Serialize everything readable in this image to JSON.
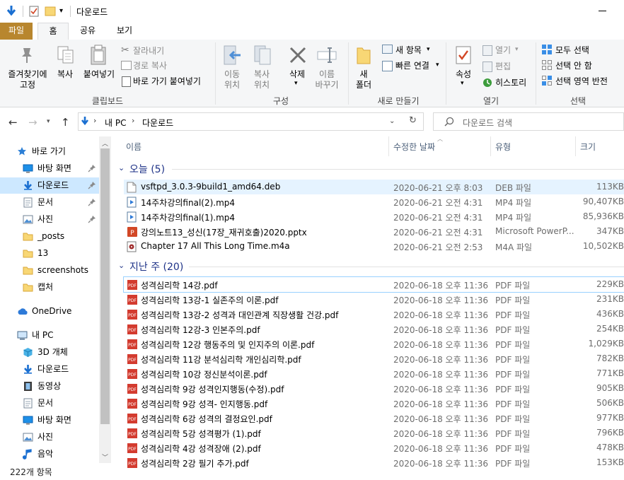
{
  "window": {
    "title": "다운로드"
  },
  "tabs": [
    {
      "label": "파일"
    },
    {
      "label": "홈"
    },
    {
      "label": "공유"
    },
    {
      "label": "보기"
    }
  ],
  "ribbon": {
    "clipboard": {
      "pin_label": "즐겨찾기에\n고정",
      "copy_label": "복사",
      "paste_label": "붙여넣기",
      "cut_label": "잘라내기",
      "copy_path_label": "경로 복사",
      "paste_shortcut_label": "바로 가기 붙여넣기",
      "group_label": "클립보드"
    },
    "organize": {
      "move_label": "이동\n위치",
      "copyto_label": "복사\n위치",
      "delete_label": "삭제",
      "rename_label": "이름\n바꾸기",
      "group_label": "구성"
    },
    "new": {
      "folder_label": "새\n폴더",
      "new_item_label": "새 항목",
      "easy_access_label": "빠른 연결",
      "group_label": "새로 만들기"
    },
    "open": {
      "properties_label": "속성",
      "open_label": "열기",
      "edit_label": "편집",
      "history_label": "히스토리",
      "group_label": "열기"
    },
    "select": {
      "select_all_label": "모두 선택",
      "select_none_label": "선택 안 함",
      "invert_label": "선택 영역 반전",
      "group_label": "선택"
    }
  },
  "address": {
    "path": [
      "내 PC",
      "다운로드"
    ],
    "search_placeholder": "다운로드 검색"
  },
  "nav": [
    {
      "label": "바로 가기",
      "icon": "star-icon",
      "indent": 0,
      "pinned": false
    },
    {
      "label": "바탕 화면",
      "icon": "desktop-icon",
      "indent": 1,
      "pinned": true
    },
    {
      "label": "다운로드",
      "icon": "download-icon",
      "indent": 1,
      "pinned": true,
      "selected": true
    },
    {
      "label": "문서",
      "icon": "document-icon",
      "indent": 1,
      "pinned": true
    },
    {
      "label": "사진",
      "icon": "picture-icon",
      "indent": 1,
      "pinned": true
    },
    {
      "label": "_posts",
      "icon": "folder-icon",
      "indent": 1,
      "pinned": false
    },
    {
      "label": "13",
      "icon": "folder-icon",
      "indent": 1,
      "pinned": false
    },
    {
      "label": "screenshots",
      "icon": "folder-icon",
      "indent": 1,
      "pinned": false
    },
    {
      "label": "캡처",
      "icon": "folder-icon",
      "indent": 1,
      "pinned": false
    },
    {
      "label": "OneDrive",
      "icon": "cloud-icon",
      "indent": 0,
      "pinned": false,
      "gap": true
    },
    {
      "label": "내 PC",
      "icon": "pc-icon",
      "indent": 0,
      "pinned": false,
      "gap": true
    },
    {
      "label": "3D 개체",
      "icon": "cube-icon",
      "indent": 1,
      "pinned": false
    },
    {
      "label": "다운로드",
      "icon": "download-icon",
      "indent": 1,
      "pinned": false
    },
    {
      "label": "동영상",
      "icon": "video-icon",
      "indent": 1,
      "pinned": false
    },
    {
      "label": "문서",
      "icon": "document-icon",
      "indent": 1,
      "pinned": false
    },
    {
      "label": "바탕 화면",
      "icon": "desktop-icon",
      "indent": 1,
      "pinned": false
    },
    {
      "label": "사진",
      "icon": "picture-icon",
      "indent": 1,
      "pinned": false
    },
    {
      "label": "음악",
      "icon": "music-icon",
      "indent": 1,
      "pinned": false
    }
  ],
  "columns": {
    "name": "이름",
    "date": "수정한 날짜",
    "type": "유형",
    "size": "크기"
  },
  "groups": [
    {
      "label": "오늘 (5)",
      "files": [
        {
          "name": "vsftpd_3.0.3-9build1_amd64.deb",
          "date": "2020-06-21 오후 8:03",
          "type": "DEB 파일",
          "size": "113KB",
          "kind": "deb",
          "selected": true
        },
        {
          "name": "14주차강의final(2).mp4",
          "date": "2020-06-21 오전 4:31",
          "type": "MP4 파일",
          "size": "90,407KB",
          "kind": "mp4"
        },
        {
          "name": "14주차강의final(1).mp4",
          "date": "2020-06-21 오전 4:31",
          "type": "MP4 파일",
          "size": "85,936KB",
          "kind": "mp4"
        },
        {
          "name": "강의노트13_성신(17장_재귀호출)2020.pptx",
          "date": "2020-06-21 오전 4:31",
          "type": "Microsoft PowerP...",
          "size": "347KB",
          "kind": "pptx"
        },
        {
          "name": "Chapter 17 All This Long Time.m4a",
          "date": "2020-06-21 오전 2:53",
          "type": "M4A 파일",
          "size": "10,502KB",
          "kind": "m4a"
        }
      ]
    },
    {
      "label": "지난 주 (20)",
      "files": [
        {
          "name": "성격심리학 14강.pdf",
          "date": "2020-06-18 오후 11:36",
          "type": "PDF 파일",
          "size": "229KB",
          "kind": "pdf",
          "focused": true
        },
        {
          "name": "성격심리학 13강-1 실존주의 이론.pdf",
          "date": "2020-06-18 오후 11:36",
          "type": "PDF 파일",
          "size": "231KB",
          "kind": "pdf"
        },
        {
          "name": "성격심리학 13강-2 성격과 대인관계 직장생활 건강.pdf",
          "date": "2020-06-18 오후 11:36",
          "type": "PDF 파일",
          "size": "436KB",
          "kind": "pdf"
        },
        {
          "name": "성격심리학 12강-3 인본주의.pdf",
          "date": "2020-06-18 오후 11:36",
          "type": "PDF 파일",
          "size": "254KB",
          "kind": "pdf"
        },
        {
          "name": "성격심리학 12강 행동주의 및 인지주의 이론.pdf",
          "date": "2020-06-18 오후 11:36",
          "type": "PDF 파일",
          "size": "1,029KB",
          "kind": "pdf"
        },
        {
          "name": "성격심리학 11강 분석심리학 개인심리학.pdf",
          "date": "2020-06-18 오후 11:36",
          "type": "PDF 파일",
          "size": "782KB",
          "kind": "pdf"
        },
        {
          "name": "성격심리학 10강 정신분석이론.pdf",
          "date": "2020-06-18 오후 11:36",
          "type": "PDF 파일",
          "size": "771KB",
          "kind": "pdf"
        },
        {
          "name": "성격심리학 9강 성격인지행동(수정).pdf",
          "date": "2020-06-18 오후 11:36",
          "type": "PDF 파일",
          "size": "905KB",
          "kind": "pdf"
        },
        {
          "name": "성격심리학 9강 성격- 인지행동.pdf",
          "date": "2020-06-18 오후 11:36",
          "type": "PDF 파일",
          "size": "506KB",
          "kind": "pdf"
        },
        {
          "name": "성격심리학 6강 성격의 결정요인.pdf",
          "date": "2020-06-18 오후 11:36",
          "type": "PDF 파일",
          "size": "977KB",
          "kind": "pdf"
        },
        {
          "name": "성격심리학 5강 성격평가 (1).pdf",
          "date": "2020-06-18 오후 11:36",
          "type": "PDF 파일",
          "size": "796KB",
          "kind": "pdf"
        },
        {
          "name": "성격심리학 4강 성격장애 (2).pdf",
          "date": "2020-06-18 오후 11:36",
          "type": "PDF 파일",
          "size": "478KB",
          "kind": "pdf"
        },
        {
          "name": "성격심리학 2강 필기 추가.pdf",
          "date": "2020-06-18 오후 11:36",
          "type": "PDF 파일",
          "size": "153KB",
          "kind": "pdf"
        }
      ]
    }
  ],
  "status": {
    "item_count": "222개 항목"
  },
  "colors": {
    "accent": "#0078d7",
    "file_tab": "#b8862e",
    "selection": "#cde8ff",
    "group_header": "#1e3287"
  }
}
